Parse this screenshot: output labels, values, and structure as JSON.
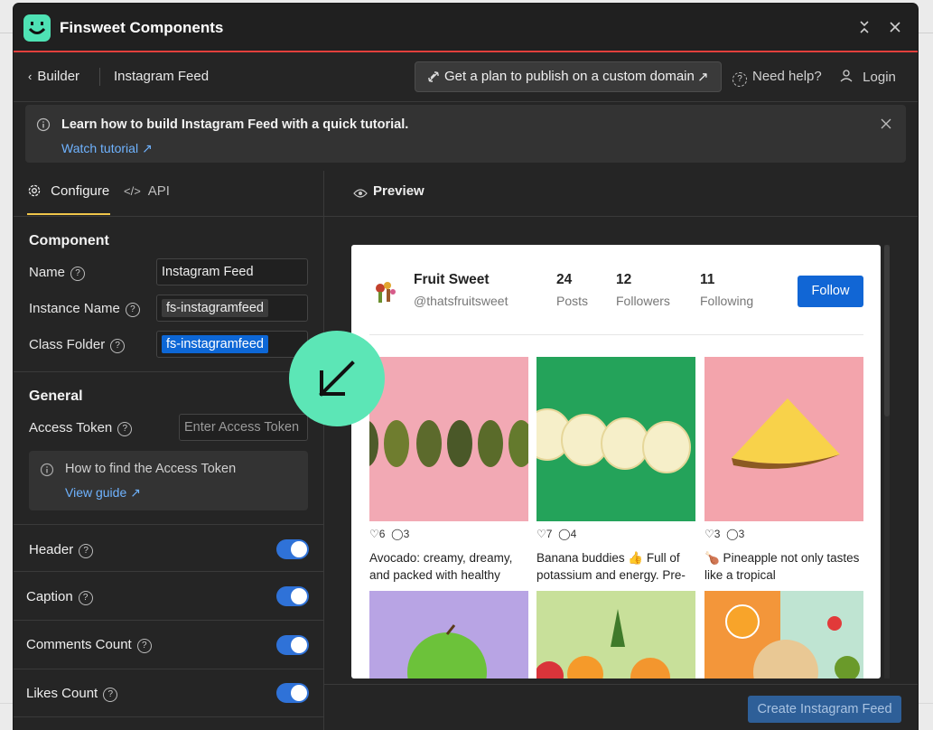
{
  "app": {
    "title": "Finsweet Components"
  },
  "nav": {
    "back_label": "Builder",
    "page_title": "Instagram Feed",
    "plan_button": "Get a plan to publish on a custom domain",
    "help": "Need help?",
    "login": "Login"
  },
  "banner": {
    "title": "Learn how to build Instagram Feed with a quick tutorial.",
    "link": "Watch tutorial"
  },
  "tabs": {
    "configure": "Configure",
    "api": "API"
  },
  "component": {
    "section": "Component",
    "name_label": "Name",
    "name_value": "Instagram Feed",
    "instance_label": "Instance Name",
    "instance_value": "fs-instagramfeed",
    "class_label": "Class Folder",
    "class_value": "fs-instagramfeed"
  },
  "general": {
    "section": "General",
    "token_label": "Access Token",
    "token_placeholder": "Enter Access Token",
    "hint_text": "How to find the Access Token",
    "hint_link": "View guide"
  },
  "toggles": [
    {
      "label": "Header",
      "on": true
    },
    {
      "label": "Caption",
      "on": true
    },
    {
      "label": "Comments Count",
      "on": true
    },
    {
      "label": "Likes Count",
      "on": true
    }
  ],
  "preview": {
    "title": "Preview",
    "profile": {
      "name": "Fruit Sweet",
      "handle": "@thatsfruitsweet"
    },
    "stats": [
      {
        "num": "24",
        "label": "Posts"
      },
      {
        "num": "12",
        "label": "Followers"
      },
      {
        "num": "11",
        "label": "Following"
      }
    ],
    "follow": "Follow",
    "posts": [
      {
        "likes": "6",
        "comments": "3",
        "caption": "Avocado: creamy, dreamy, and packed with healthy"
      },
      {
        "likes": "7",
        "comments": "4",
        "caption": "Banana buddies 👍 Full of potassium and energy. Pre-"
      },
      {
        "likes": "3",
        "comments": "3",
        "caption": "🍗 Pineapple not only tastes like a tropical"
      }
    ]
  },
  "footer": {
    "create": "Create Instagram Feed"
  },
  "colors": {
    "accent": "#1166d5",
    "brand": "#4ee2b4",
    "toggle": "#2f72d8",
    "link": "#6fb3ff"
  }
}
